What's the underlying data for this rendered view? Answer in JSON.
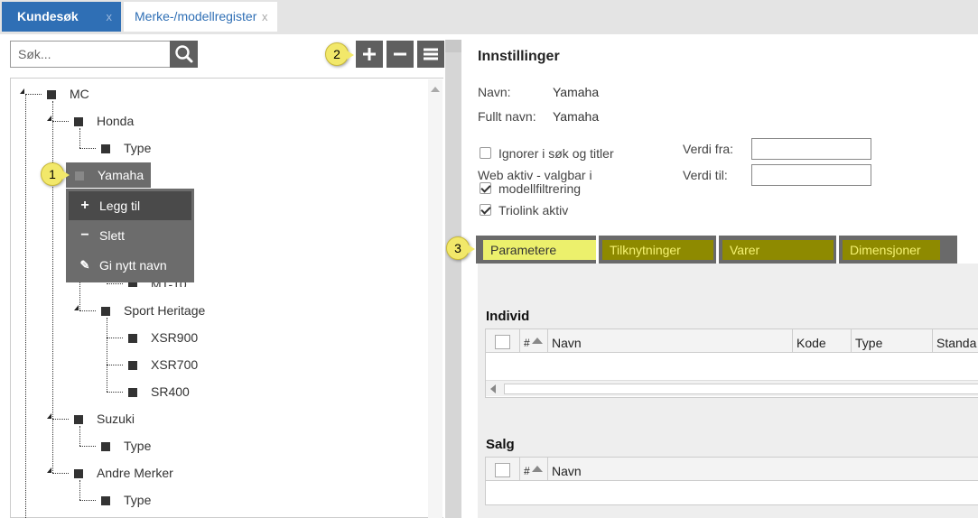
{
  "tabs": [
    {
      "label": "Kundesøk",
      "close": "x"
    },
    {
      "label": "Merke-/modellregister",
      "close": "x"
    }
  ],
  "search": {
    "placeholder": "Søk..."
  },
  "tree": {
    "mc": "MC",
    "honda": "Honda",
    "honda_type": "Type",
    "yamaha": "Yamaha",
    "mt10_partial": "MT-10",
    "sport_heritage": "Sport Heritage",
    "xsr900": "XSR900",
    "xsr700": "XSR700",
    "sr400": "SR400",
    "suzuki": "Suzuki",
    "suzuki_type": "Type",
    "andre_merker": "Andre Merker",
    "andre_type": "Type"
  },
  "context_menu": {
    "add": "Legg til",
    "delete": "Slett",
    "rename": "Gi nytt navn"
  },
  "callouts": {
    "one": "1",
    "two": "2",
    "three": "3"
  },
  "settings": {
    "title": "Innstillinger",
    "name_label": "Navn:",
    "name_value": "Yamaha",
    "fullname_label": "Fullt navn:",
    "fullname_value": "Yamaha",
    "ignore_label": "Ignorer i søk og titler",
    "ignore_checked": false,
    "web_label_line1": "Web aktiv - valgbar i",
    "web_label_line2": "modellfiltrering",
    "web_checked": true,
    "triolink_label": "Triolink aktiv",
    "triolink_checked": true,
    "value_from_label": "Verdi fra:",
    "value_to_label": "Verdi til:",
    "value_from": "",
    "value_to": ""
  },
  "detail_tabs": [
    "Parametere",
    "Tilknytninger",
    "Varer",
    "Dimensjoner"
  ],
  "individ": {
    "title": "Individ",
    "columns": [
      "#",
      "Navn",
      "Kode",
      "Type",
      "Standa"
    ]
  },
  "salg": {
    "title": "Salg",
    "columns": [
      "#",
      "Navn"
    ]
  },
  "colors": {
    "tab_active": "#2f6fb5",
    "highlight": "#ecf06c",
    "toolbar": "#5f5f5f"
  }
}
